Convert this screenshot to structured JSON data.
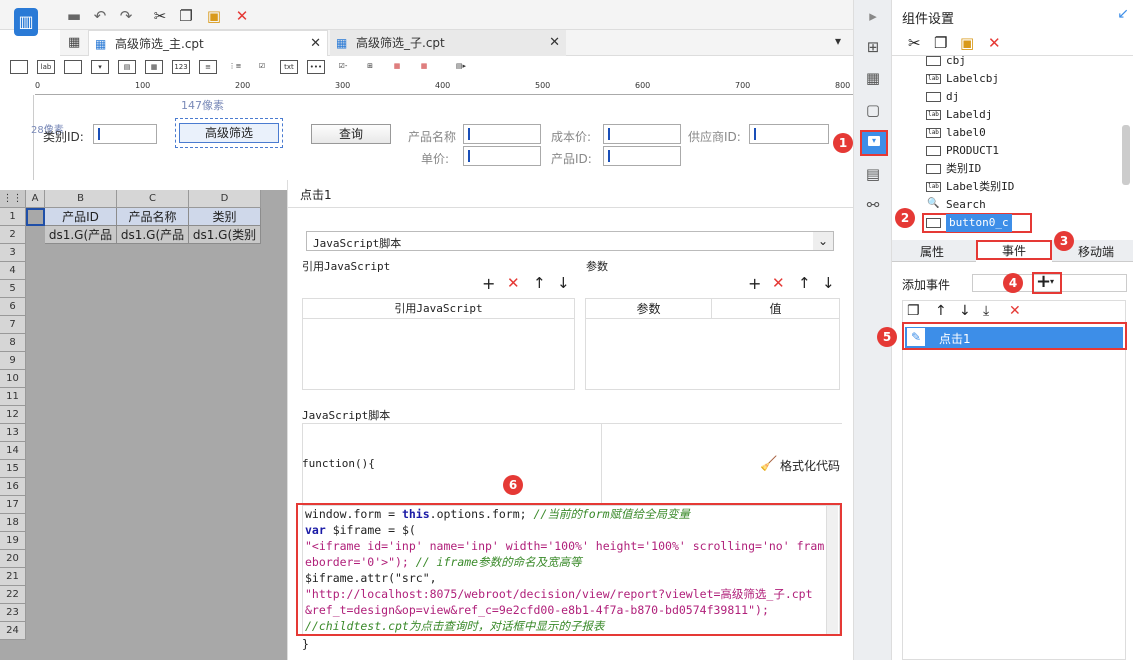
{
  "toolbar": {
    "tabs": [
      {
        "label": "高级筛选_主.cpt",
        "active": true
      },
      {
        "label": "高级筛选_子.cpt",
        "active": false
      }
    ]
  },
  "ruler": {
    "ticks": [
      "0",
      "100",
      "200",
      "300",
      "400",
      "500",
      "600",
      "700",
      "800"
    ],
    "pixel_hint_h": "147像素",
    "pixel_hint_v": "28像素"
  },
  "form": {
    "category_label": "类别ID:",
    "filter_button": "高级筛选",
    "query_button": "查询",
    "product_name_label": "产品名称",
    "cost_label": "成本价:",
    "supplier_label": "供应商ID:",
    "unit_price_label": "单价:",
    "product_id_label": "产品ID:"
  },
  "grid": {
    "columns": [
      "A",
      "B",
      "C",
      "D"
    ],
    "headers": [
      "产品ID",
      "产品名称",
      "类别"
    ],
    "row2": [
      "ds1.G(产品",
      "ds1.G(产品",
      "ds1.G(类别"
    ],
    "rows": [
      "1",
      "2",
      "3",
      "4",
      "5",
      "6",
      "7",
      "8",
      "9",
      "10",
      "11",
      "12",
      "13",
      "14",
      "15",
      "16",
      "17",
      "18",
      "19",
      "20",
      "21",
      "22",
      "23",
      "24"
    ]
  },
  "event_panel": {
    "title": "点击1",
    "type_select": "JavaScript脚本",
    "ref_js_label": "引用JavaScript",
    "params_label": "参数",
    "ref_js_col": "引用JavaScript",
    "param_col": "参数",
    "value_col": "值",
    "script_label": "JavaScript脚本",
    "function_open": "function(){",
    "format_code": "格式化代码",
    "function_close": "}"
  },
  "code_lines": {
    "l1a": "window.form = ",
    "l1b": "this",
    "l1c": ".options.form; ",
    "l1d": "//当前的form赋值给全局变量",
    "l2a": "var",
    "l2b": " $iframe = $(",
    "l3": "\"<iframe id='inp' name='inp' width='100%' height='100%' scrolling='no' fram",
    "l4a": "eborder='0'>\"); ",
    "l4b": "// iframe参数的命名及宽高等",
    "l5": "$iframe.attr(\"src\",",
    "l6": "\"http://localhost:8075/webroot/decision/view/report?viewlet=高级筛选_子.cpt",
    "l7": "&ref_t=design&op=view&ref_c=9e2cfd00-e8b1-4f7a-b870-bd0574f39811\");",
    "l8": "//childtest.cpt为点击查询时，对话框中显示的子报表"
  },
  "right_panel": {
    "title": "组件设置",
    "tree": [
      {
        "icon": "text-field",
        "label": "cbj"
      },
      {
        "icon": "label",
        "label": "Labelcbj"
      },
      {
        "icon": "text-field",
        "label": "dj"
      },
      {
        "icon": "label",
        "label": "Labeldj"
      },
      {
        "icon": "label",
        "label": "label0"
      },
      {
        "icon": "text-field",
        "label": "PRODUCT1"
      },
      {
        "icon": "text-field",
        "label": "类别ID"
      },
      {
        "icon": "label",
        "label": "Label类别ID"
      },
      {
        "icon": "search",
        "label": "Search"
      },
      {
        "icon": "button",
        "label": "button0_c"
      }
    ],
    "tabs": [
      "属性",
      "事件",
      "移动端"
    ],
    "add_event_label": "添加事件",
    "event_item": "点击1"
  },
  "badges": [
    "1",
    "2",
    "3",
    "4",
    "5",
    "6"
  ],
  "colors": {
    "accent": "#2a7ad6",
    "highlight": "#e53935",
    "selected": "#3d8ee8"
  }
}
